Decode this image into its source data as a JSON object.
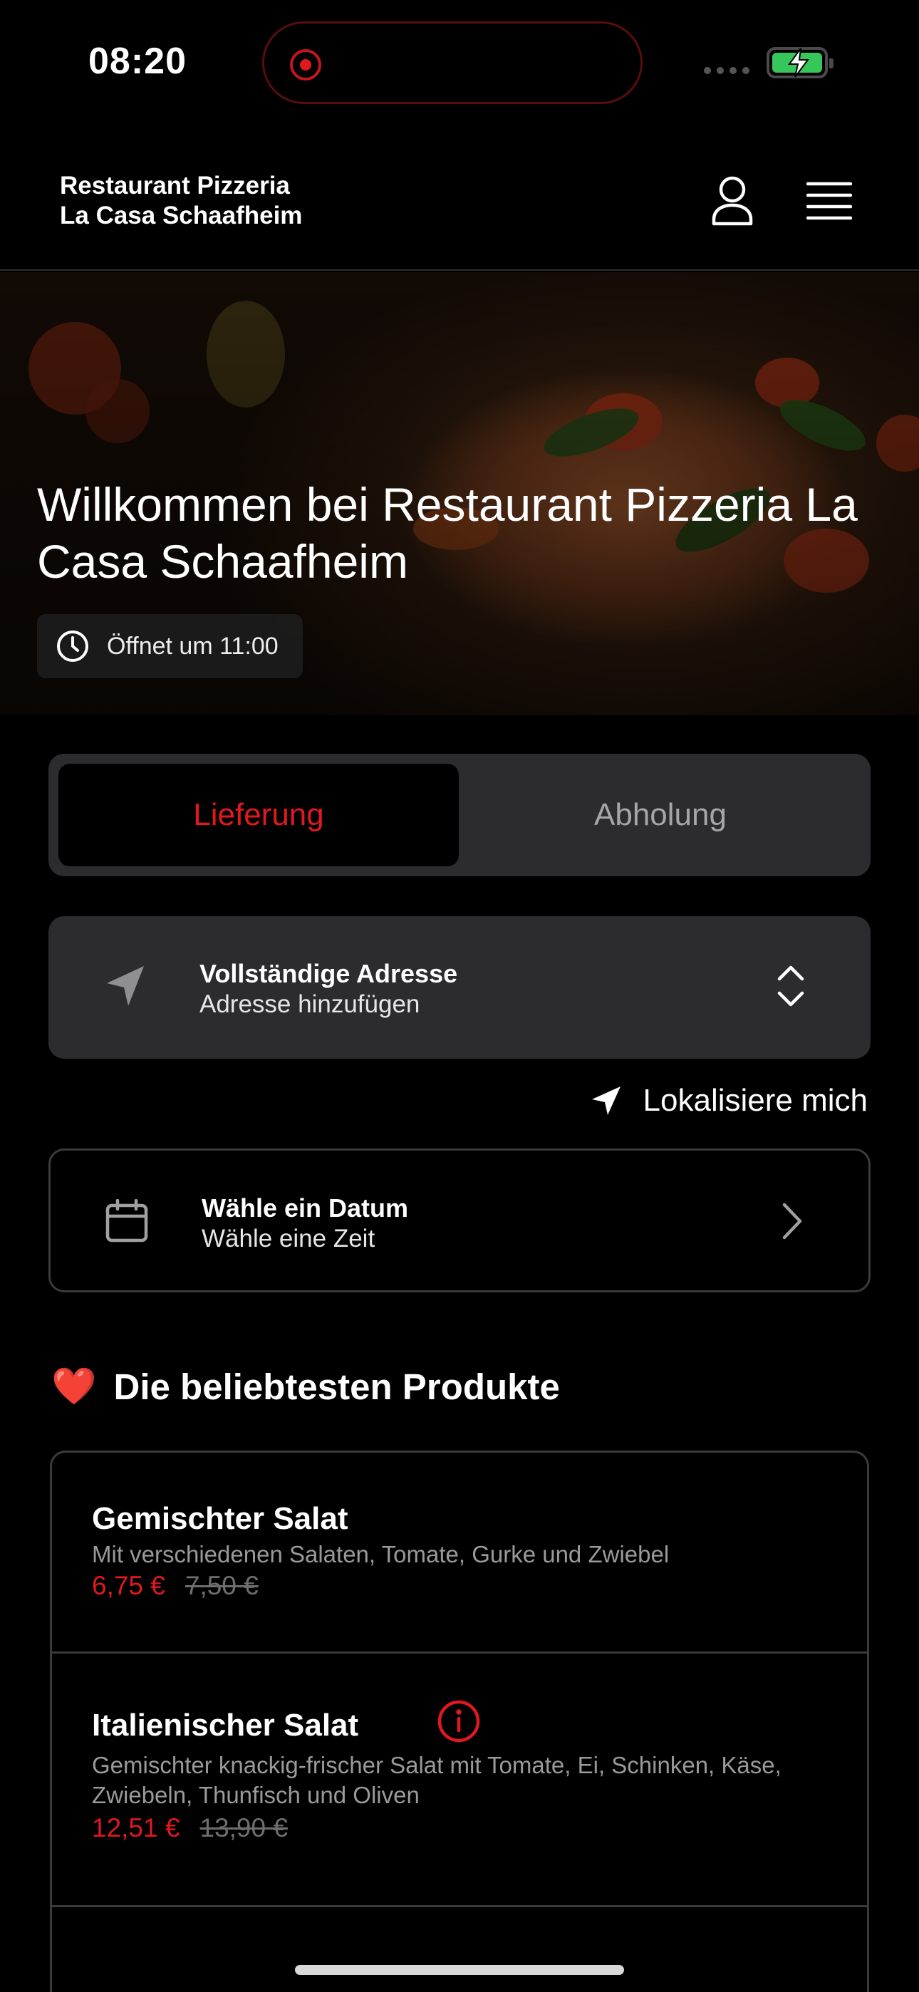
{
  "status_bar": {
    "time": "08:20"
  },
  "header": {
    "brand_line1": "Restaurant Pizzeria",
    "brand_line2": "La Casa Schaafheim",
    "icons": [
      "user-icon",
      "hamburger-menu-icon"
    ]
  },
  "hero": {
    "title": "Willkommen bei Restaurant Pizzeria La Casa Schaafheim",
    "opening_text": "Öffnet um 11:00"
  },
  "order_mode": {
    "options": [
      {
        "label": "Lieferung",
        "active": true
      },
      {
        "label": "Abholung",
        "active": false
      }
    ],
    "accent_color": "#e0191f"
  },
  "address": {
    "title": "Vollständige Adresse",
    "subtitle": "Adresse hinzufügen"
  },
  "locate": {
    "label": "Lokalisiere mich"
  },
  "datetime": {
    "title": "Wähle ein Datum",
    "subtitle": "Wähle eine Zeit"
  },
  "popular": {
    "emoji": "❤️",
    "title": "Die beliebtesten Produkte",
    "products": [
      {
        "name": "Gemischter Salat",
        "description": "Mit verschiedenen Salaten, Tomate, Gurke und Zwiebel",
        "price": "6,75 €",
        "old_price": "7,50 €"
      },
      {
        "name": "Italienischer Salat",
        "description": "Gemischter knackig-frischer Salat mit Tomate, Ei, Schinken, Käse, Zwiebeln, Thunfisch und Oliven",
        "price": "12,51 €",
        "old_price": "13,90 €"
      }
    ]
  }
}
